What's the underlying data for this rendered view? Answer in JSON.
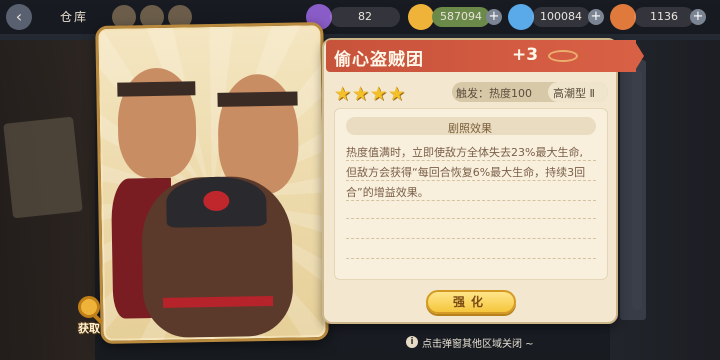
{
  "topbar": {
    "title": "仓库",
    "resources": [
      {
        "name": "stamina",
        "value": "82",
        "icon": "potion-icon",
        "color": "#8a5cc8"
      },
      {
        "name": "coins",
        "value": "587094",
        "icon": "coin-icon",
        "color": "#f0b33a"
      },
      {
        "name": "gems",
        "value": "100084",
        "icon": "gem-icon",
        "color": "#5aa9e8"
      },
      {
        "name": "tokens",
        "value": "1136",
        "icon": "ticket-icon",
        "color": "#e07a3c"
      }
    ]
  },
  "card": {
    "title": "偷心盗贼团",
    "level": "+3",
    "stars": 4,
    "trigger_label": "触发：热度100",
    "type_label": "高潮型 Ⅱ",
    "effect_title": "剧照效果",
    "description_lines": [
      "热度值满时，立即使敌方全体失去23%最大生命,",
      "但敌方会获得“每回合恢复6%最大生命，持续3回",
      "合”的增益效果。"
    ],
    "enhance_label": "强化"
  },
  "fetch_label": "获取",
  "hint": "点击弹窗其他区域关闭 ~"
}
